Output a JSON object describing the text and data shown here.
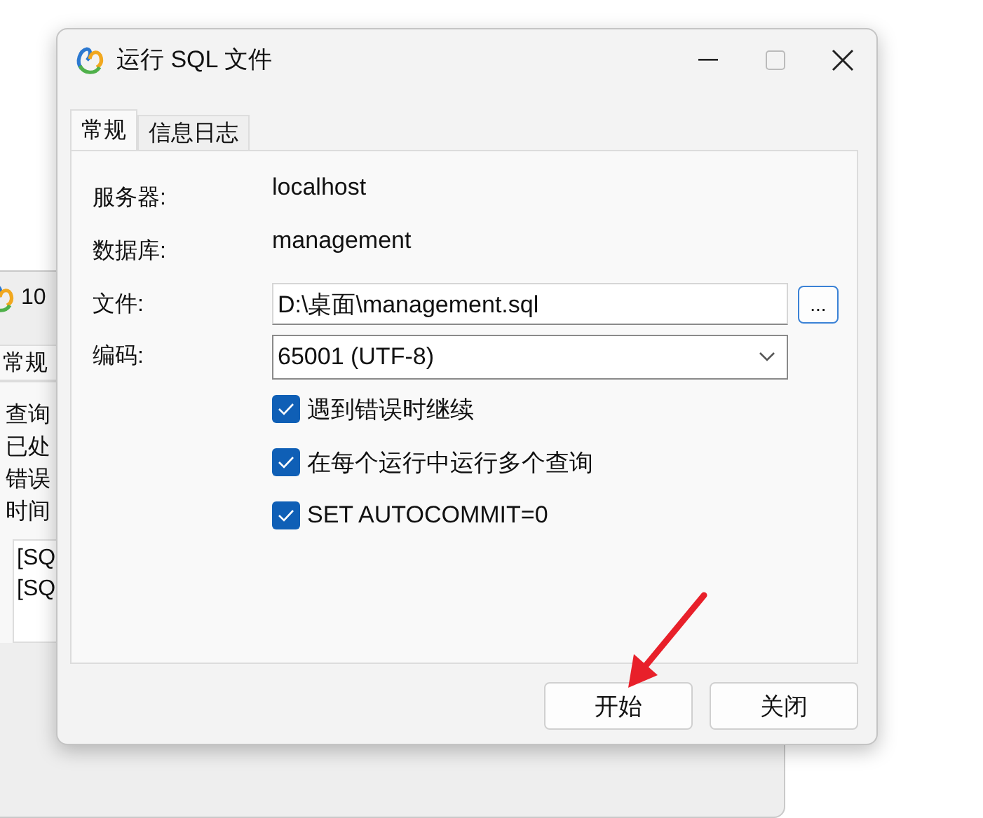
{
  "background_window": {
    "title": "10",
    "tab": "常规",
    "labels": [
      "查询",
      "已处",
      "错误",
      "时间"
    ],
    "log_lines": [
      "[SQ",
      "[SQ"
    ]
  },
  "dialog": {
    "title": "运行 SQL 文件",
    "tabs": [
      {
        "label": "常规",
        "selected": true
      },
      {
        "label": "信息日志",
        "selected": false
      }
    ],
    "fields": [
      {
        "kind": "text",
        "label": "服务器:",
        "value": "localhost"
      },
      {
        "kind": "text",
        "label": "数据库:",
        "value": "management"
      },
      {
        "kind": "file",
        "label": "文件:",
        "value": "D:\\桌面\\management.sql",
        "button": "..."
      },
      {
        "kind": "select",
        "label": "编码:",
        "value": "65001 (UTF-8)"
      }
    ],
    "options": [
      {
        "label": "遇到错误时继续",
        "checked": true
      },
      {
        "label": "在每个运行中运行多个查询",
        "checked": true
      },
      {
        "label": "SET AUTOCOMMIT=0",
        "checked": true
      }
    ],
    "buttons": [
      "开始",
      "关闭"
    ]
  },
  "annotation": {
    "kind": "arrow"
  }
}
